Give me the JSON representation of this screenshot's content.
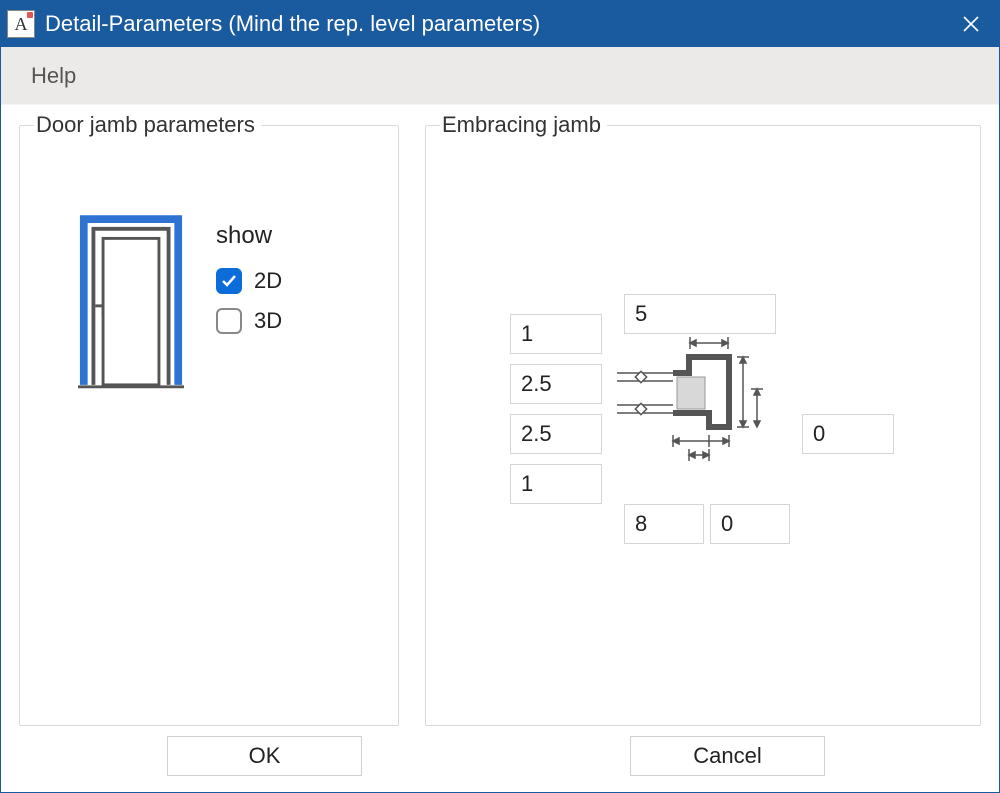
{
  "window": {
    "title": "Detail-Parameters (Mind the rep. level parameters)",
    "icon_letter": "A"
  },
  "menubar": {
    "help": "Help"
  },
  "panels": {
    "left_title": "Door jamb parameters",
    "right_title": "Embracing jamb"
  },
  "show": {
    "label": "show",
    "cb_2d_label": "2D",
    "cb_2d_checked": true,
    "cb_3d_label": "3D",
    "cb_3d_checked": false
  },
  "inputs": {
    "top_width": "5",
    "left_top": "1",
    "left_upper_mid": "2.5",
    "left_lower_mid": "2.5",
    "left_bottom": "1",
    "right_mid": "0",
    "bottom_left": "8",
    "bottom_right": "0"
  },
  "buttons": {
    "ok": "OK",
    "cancel": "Cancel"
  }
}
